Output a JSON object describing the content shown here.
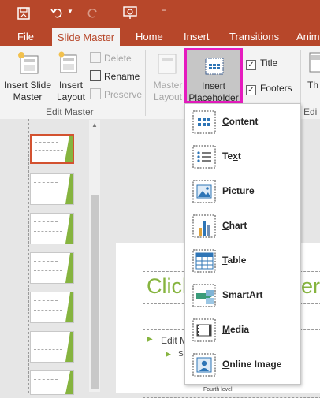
{
  "title_bar": {
    "save_icon": "save-icon",
    "undo_icon": "undo-icon",
    "redo_icon": "redo-icon",
    "present_icon": "present-from-beginning-icon",
    "customize_icon": "customize-toolbar-icon"
  },
  "tabs": [
    "File",
    "Slide Master",
    "Home",
    "Insert",
    "Transitions",
    "Anim"
  ],
  "active_tab": "Slide Master",
  "ribbon": {
    "insert_slide_master": [
      "Insert Slide",
      "Master"
    ],
    "insert_layout": [
      "Insert",
      "Layout"
    ],
    "delete": "Delete",
    "rename": "Rename",
    "preserve": "Preserve",
    "group_edit_master": "Edit Master",
    "master_layout": [
      "Master",
      "Layout"
    ],
    "insert_placeholder": [
      "Insert",
      "Placeholder"
    ],
    "title_check": "Title",
    "footers_check": "Footers",
    "themes_partial": "Th",
    "edit_partial": "Edi"
  },
  "placeholder_menu": [
    {
      "label": "Content",
      "accel": "C",
      "rest": "ontent",
      "icon": "content-placeholder-icon"
    },
    {
      "label": "Text",
      "accel": "x",
      "pre": "Te",
      "rest": "t",
      "icon": "text-placeholder-icon"
    },
    {
      "label": "Picture",
      "accel": "P",
      "rest": "icture",
      "icon": "picture-placeholder-icon"
    },
    {
      "label": "Chart",
      "accel": "C",
      "rest": "hart",
      "icon": "chart-placeholder-icon"
    },
    {
      "label": "Table",
      "accel": "T",
      "rest": "able",
      "icon": "table-placeholder-icon"
    },
    {
      "label": "SmartArt",
      "accel": "S",
      "rest": "martArt",
      "icon": "smartart-placeholder-icon"
    },
    {
      "label": "Media",
      "accel": "M",
      "rest": "edia",
      "icon": "media-placeholder-icon"
    },
    {
      "label": "Online Image",
      "accel": "O",
      "rest": "nline Image",
      "icon": "online-image-placeholder-icon"
    }
  ],
  "slide": {
    "title_left": "Click",
    "title_right": "er",
    "bullet_1": "Edit M",
    "bullet_2": "Se",
    "bullet_5": "Fourth level"
  },
  "colors": {
    "accent": "#b7472a",
    "highlight": "#e51bbe",
    "green": "#86b43f"
  }
}
